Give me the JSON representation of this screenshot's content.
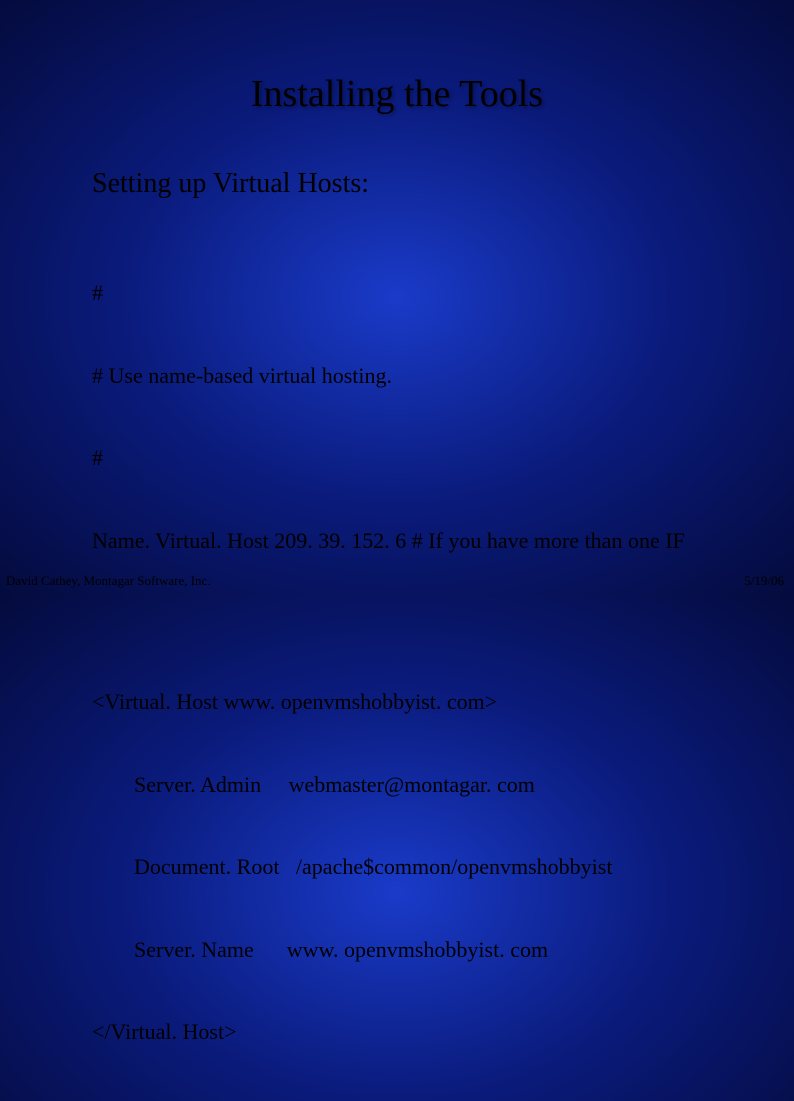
{
  "title": "Installing the Tools",
  "subtitle": "Setting up Virtual Hosts:",
  "block1": {
    "l1": "#",
    "l2": "# Use name-based virtual hosting.",
    "l3": "#",
    "l4": "Name. Virtual. Host 209. 39. 152. 6 # If you have more than one IF"
  },
  "block2": {
    "l1": "<Virtual. Host www. openvmshobbyist. com>",
    "l2": "Server. Admin     webmaster@montagar. com",
    "l3": "Document. Root   /apache$common/openvmshobbyist",
    "l4": "Server. Name      www. openvmshobbyist. com",
    "l5": "</Virtual. Host>"
  },
  "footer": {
    "author": "David Cathey, Montagar Software, Inc.",
    "date": "5/19/06"
  }
}
